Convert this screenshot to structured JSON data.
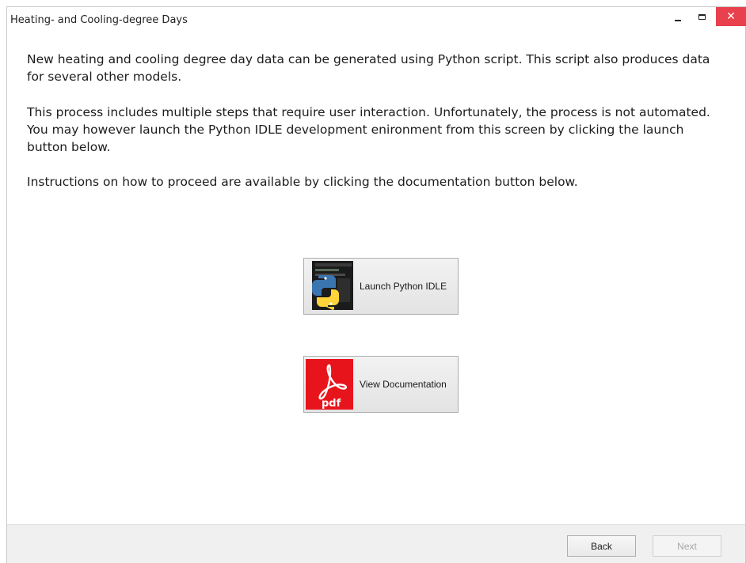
{
  "window": {
    "title": "Heating- and Cooling-degree Days",
    "close_glyph": "✕"
  },
  "content": {
    "paragraphs": [
      "New heating and cooling degree day data can be generated using Python script. This script also produces data for several other models.",
      "This process includes multiple steps that require user interaction. Unfortunately, the process is not automated. You may however launch the Python IDLE development enironment from this screen by clicking the launch button below.",
      "Instructions on how to proceed are available by clicking the documentation button below."
    ]
  },
  "buttons": {
    "launch_label": "Launch Python IDLE",
    "launch_icon": "python-icon",
    "docs_label": "View Documentation",
    "docs_icon": "pdf-icon",
    "pdf_text": "pdf"
  },
  "footer": {
    "back_label": "Back",
    "next_label": "Next",
    "next_enabled": false
  },
  "colors": {
    "close_red": "#e8404c",
    "pdf_red": "#e8141c",
    "python_blue": "#3a75b0",
    "python_yellow": "#ffd43b"
  }
}
